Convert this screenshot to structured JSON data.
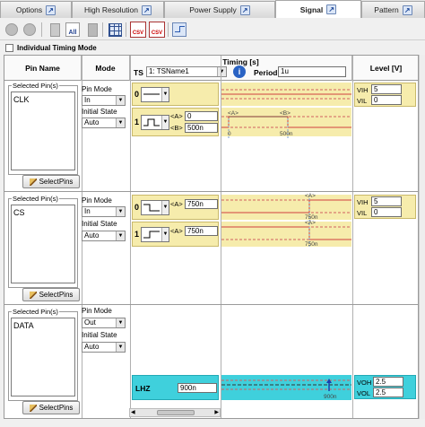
{
  "tabs": [
    {
      "label": "Options"
    },
    {
      "label": "High Resolution"
    },
    {
      "label": "Power Supply"
    },
    {
      "label": "Signal"
    },
    {
      "label": "Pattern"
    }
  ],
  "toolbar": {
    "all_label": "All",
    "csv_label": "CSV"
  },
  "individual_timing_mode_label": "Individual Timing Mode",
  "headers": {
    "pin_name": "Pin Name",
    "mode": "Mode",
    "timing": "Timing [s]",
    "level": "Level [V]"
  },
  "timing_bar": {
    "ts_label": "TS",
    "ts_value": "1: TSName1",
    "period_label": "Period",
    "period_value": "1u",
    "info_icon": "i"
  },
  "rows": [
    {
      "selected_pins_label": "Selected Pin(s)",
      "pin": "CLK",
      "select_pins_label": "SelectPins",
      "pin_mode_label": "Pin Mode",
      "pin_mode": "In",
      "initial_state_label": "Initial State",
      "initial_state": "Auto",
      "lines": [
        {
          "index": "0",
          "fields": [
            {
              "tag": "",
              "value": ""
            }
          ]
        },
        {
          "index": "1",
          "fields": [
            {
              "tag": "<A>",
              "value": "0"
            },
            {
              "tag": "<B>",
              "value": "500n"
            }
          ]
        }
      ],
      "wave_labels": {
        "a": "<A>",
        "b": "<B>",
        "t0": "0",
        "t1": "500n"
      },
      "level": [
        {
          "label": "VIH",
          "value": "5"
        },
        {
          "label": "VIL",
          "value": "0"
        }
      ]
    },
    {
      "selected_pins_label": "Selected Pin(s)",
      "pin": "CS",
      "select_pins_label": "SelectPins",
      "pin_mode_label": "Pin Mode",
      "pin_mode": "In",
      "initial_state_label": "Initial State",
      "initial_state": "Auto",
      "lines": [
        {
          "index": "0",
          "fields": [
            {
              "tag": "<A>",
              "value": "750n"
            }
          ]
        },
        {
          "index": "1",
          "fields": [
            {
              "tag": "<A>",
              "value": "750n"
            }
          ]
        }
      ],
      "wave_labels": {
        "a": "<A>",
        "t": "750n"
      },
      "level": [
        {
          "label": "VIH",
          "value": "5"
        },
        {
          "label": "VIL",
          "value": "0"
        }
      ]
    },
    {
      "selected_pins_label": "Selected Pin(s)",
      "pin": "DATA",
      "select_pins_label": "SelectPins",
      "pin_mode_label": "Pin Mode",
      "pin_mode": "Out",
      "initial_state_label": "Initial State",
      "initial_state": "Auto",
      "lines": [
        {
          "index": "LHZ",
          "fields": [
            {
              "tag": "",
              "value": "900n"
            }
          ]
        }
      ],
      "wave_labels": {
        "t": "900n"
      },
      "level": [
        {
          "label": "VOH",
          "value": "2.5"
        },
        {
          "label": "VOL",
          "value": "2.5"
        }
      ]
    }
  ]
}
